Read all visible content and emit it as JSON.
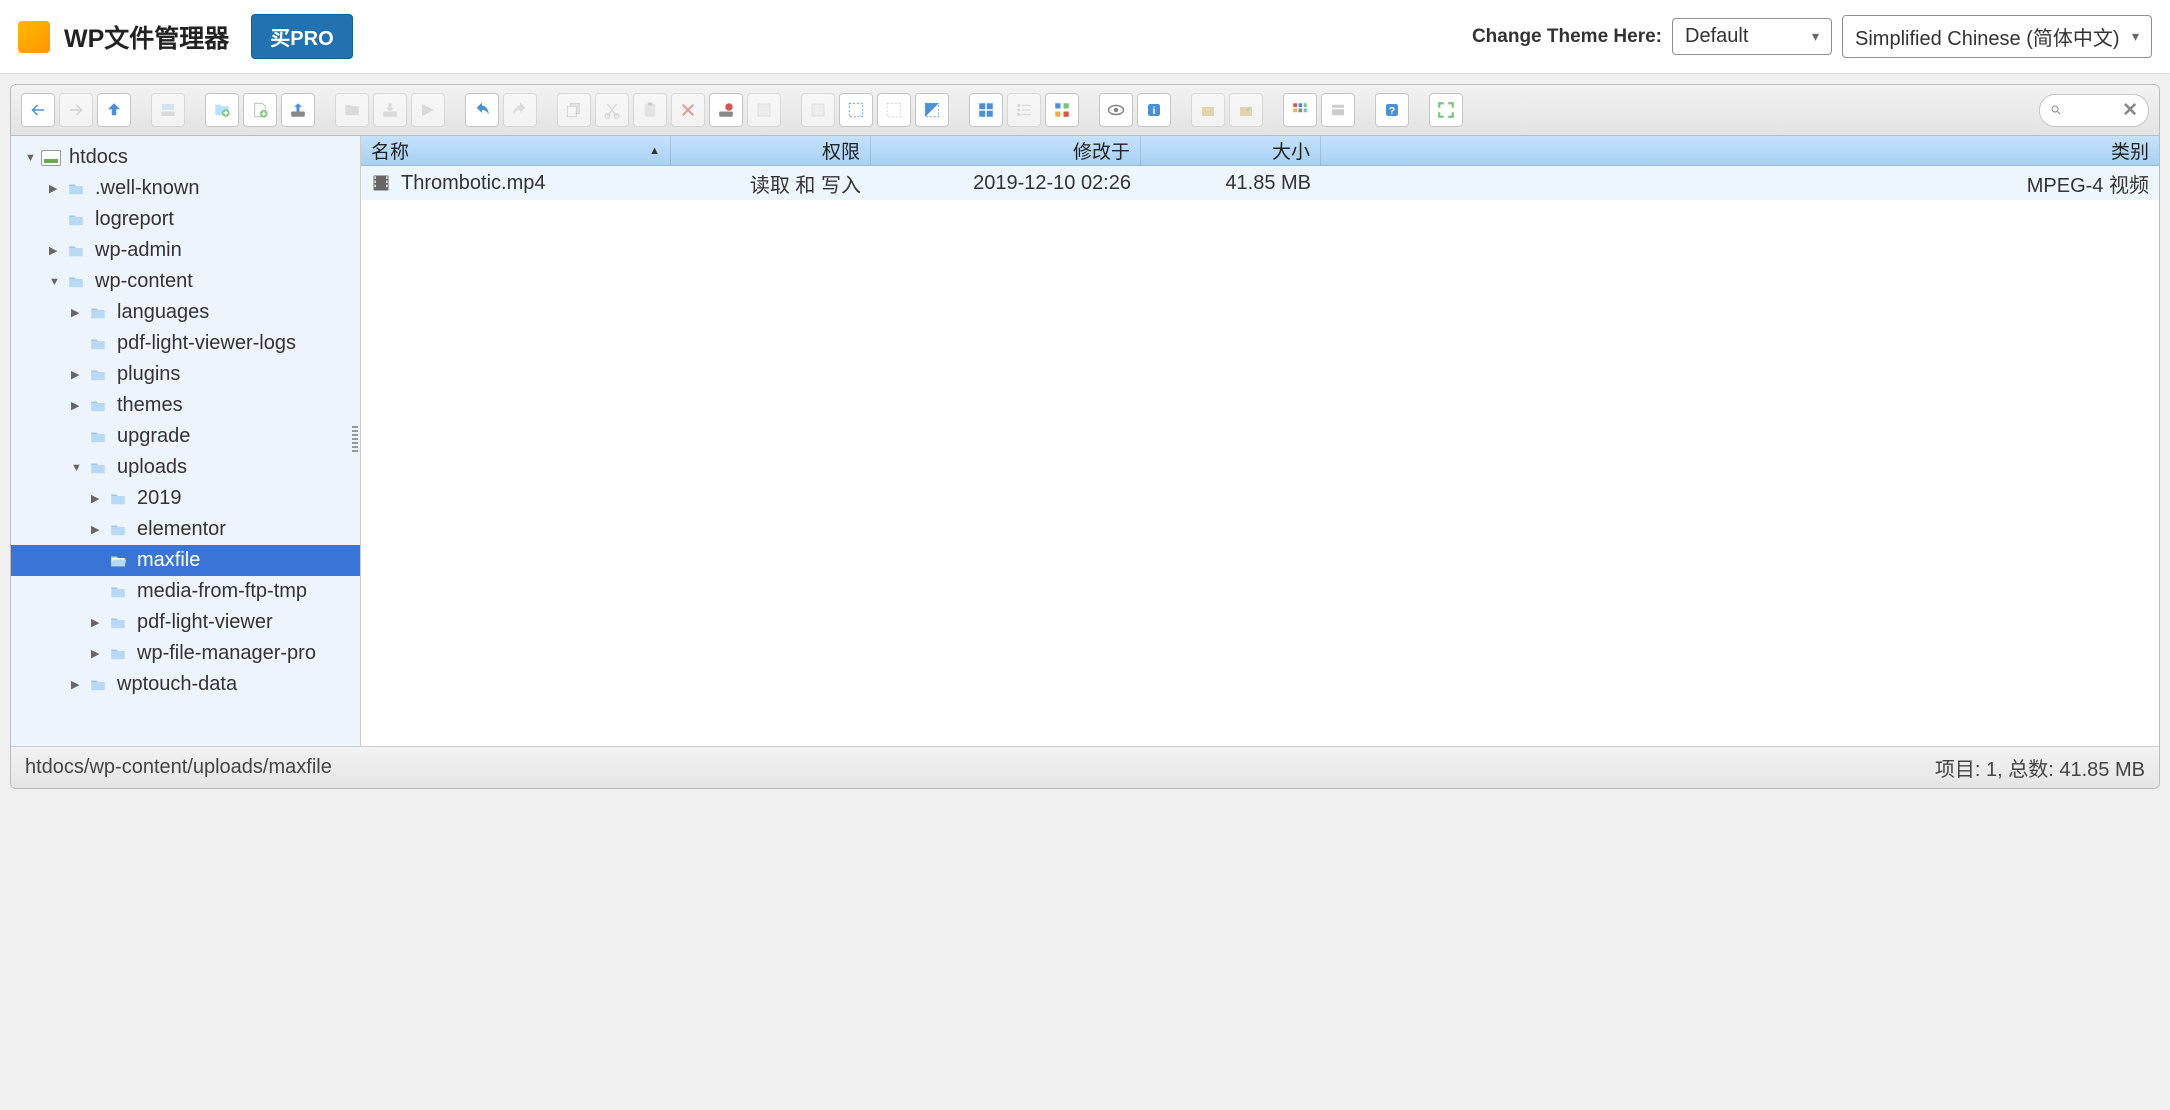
{
  "header": {
    "title": "WP文件管理器",
    "pro_label": "买PRO",
    "theme_label": "Change Theme Here:",
    "theme_value": "Default",
    "lang_value": "Simplified Chinese (简体中文)"
  },
  "toolbar": {
    "search_placeholder": ""
  },
  "tree": [
    {
      "label": "htdocs",
      "depth": 0,
      "arrow": "▼",
      "icon": "disk",
      "selected": false
    },
    {
      "label": ".well-known",
      "depth": 1,
      "arrow": "▶",
      "icon": "folder",
      "selected": false
    },
    {
      "label": "logreport",
      "depth": 1,
      "arrow": "",
      "icon": "folder",
      "selected": false
    },
    {
      "label": "wp-admin",
      "depth": 1,
      "arrow": "▶",
      "icon": "folder",
      "selected": false
    },
    {
      "label": "wp-content",
      "depth": 1,
      "arrow": "▼",
      "icon": "folder",
      "selected": false
    },
    {
      "label": "languages",
      "depth": 2,
      "arrow": "▶",
      "icon": "folder",
      "selected": false
    },
    {
      "label": "pdf-light-viewer-logs",
      "depth": 2,
      "arrow": "",
      "icon": "folder",
      "selected": false
    },
    {
      "label": "plugins",
      "depth": 2,
      "arrow": "▶",
      "icon": "folder",
      "selected": false
    },
    {
      "label": "themes",
      "depth": 2,
      "arrow": "▶",
      "icon": "folder",
      "selected": false
    },
    {
      "label": "upgrade",
      "depth": 2,
      "arrow": "",
      "icon": "folder",
      "selected": false
    },
    {
      "label": "uploads",
      "depth": 2,
      "arrow": "▼",
      "icon": "folder",
      "selected": false
    },
    {
      "label": "2019",
      "depth": 3,
      "arrow": "▶",
      "icon": "folder",
      "selected": false
    },
    {
      "label": "elementor",
      "depth": 3,
      "arrow": "▶",
      "icon": "folder",
      "selected": false
    },
    {
      "label": "maxfile",
      "depth": 3,
      "arrow": "",
      "icon": "folder-open",
      "selected": true
    },
    {
      "label": "media-from-ftp-tmp",
      "depth": 3,
      "arrow": "",
      "icon": "folder",
      "selected": false
    },
    {
      "label": "pdf-light-viewer",
      "depth": 3,
      "arrow": "▶",
      "icon": "folder",
      "selected": false
    },
    {
      "label": "wp-file-manager-pro",
      "depth": 3,
      "arrow": "▶",
      "icon": "folder",
      "selected": false
    },
    {
      "label": "wptouch-data",
      "depth": 2,
      "arrow": "▶",
      "icon": "folder",
      "selected": false
    }
  ],
  "columns": {
    "name": "名称",
    "perm": "权限",
    "date": "修改于",
    "size": "大小",
    "kind": "类别"
  },
  "files": [
    {
      "name": "Thrombotic.mp4",
      "perm": "读取 和 写入",
      "date": "2019-12-10 02:26",
      "size": "41.85 MB",
      "kind": "MPEG-4 视频"
    }
  ],
  "status": {
    "path": "htdocs/wp-content/uploads/maxfile",
    "summary": "项目: 1, 总数: 41.85 MB"
  }
}
